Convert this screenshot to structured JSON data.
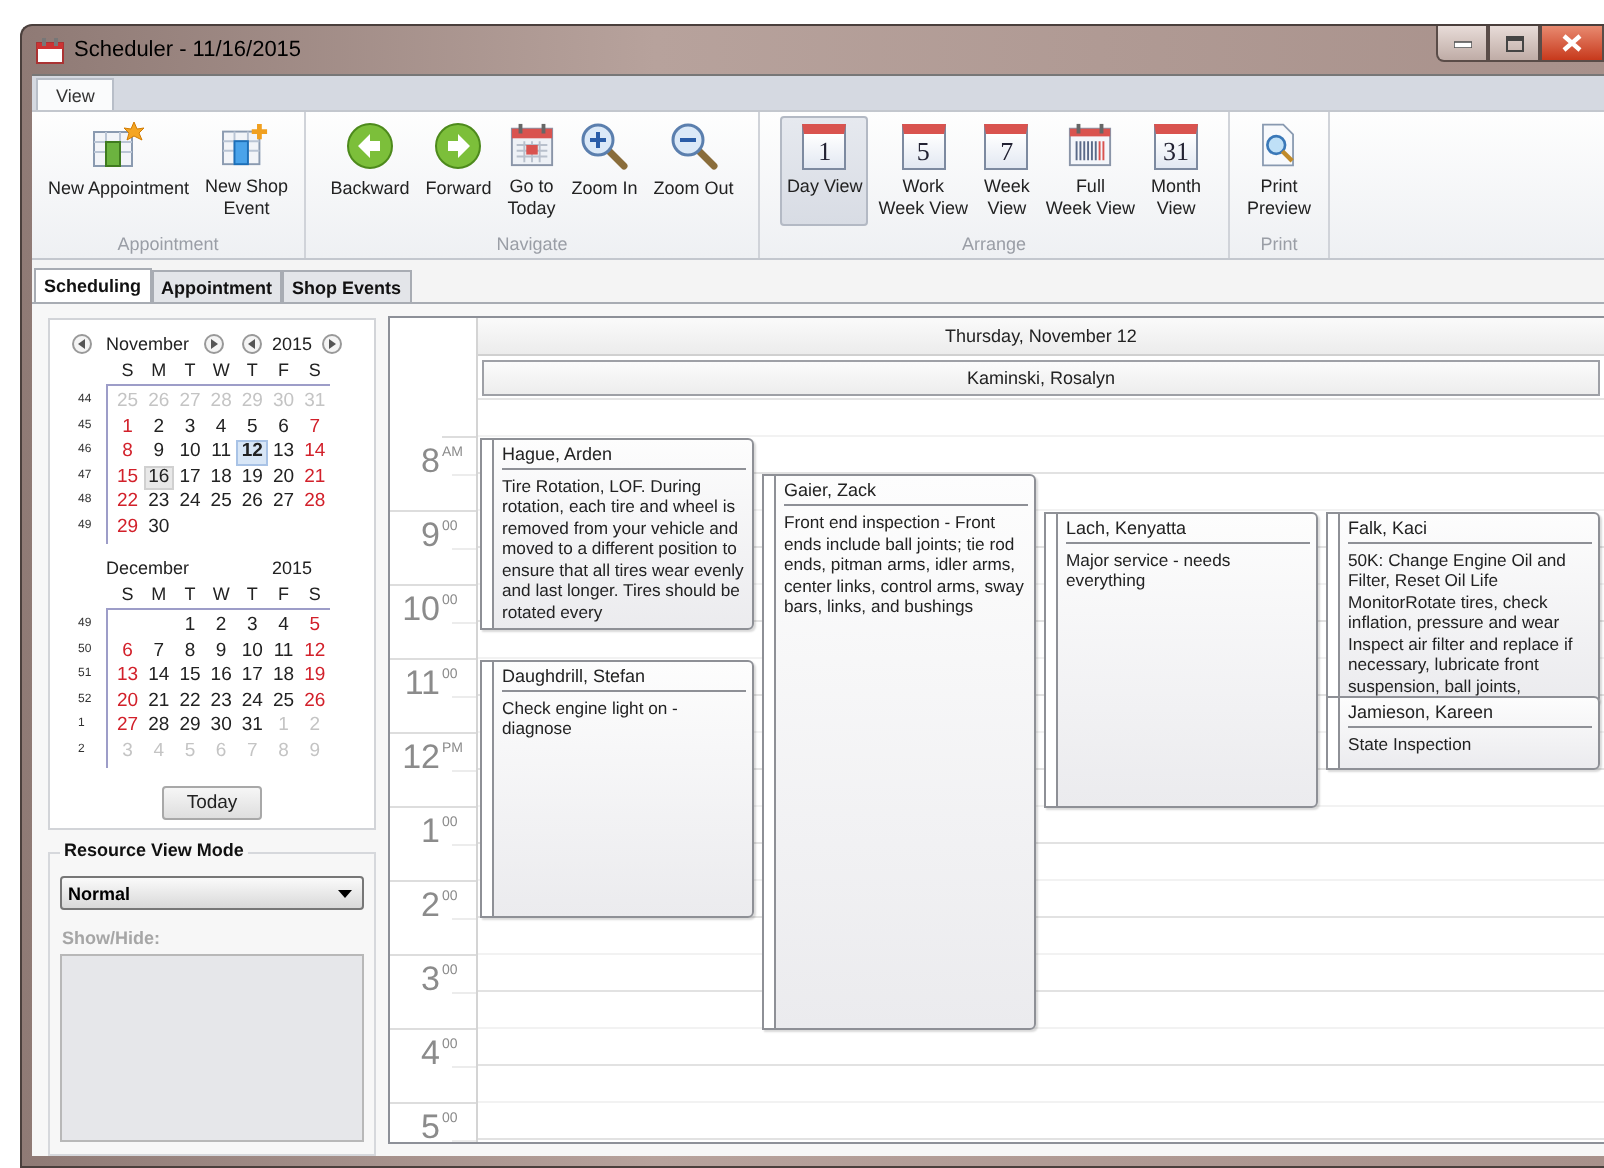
{
  "window": {
    "title": "Scheduler - 11/16/2015"
  },
  "ribbon": {
    "tabs": [
      {
        "label": "View",
        "selected": true
      }
    ],
    "groups": [
      {
        "label": "Appointment",
        "buttons": [
          {
            "lines": [
              "New Appointment"
            ],
            "selected": false
          },
          {
            "lines": [
              "New Shop",
              "Event"
            ],
            "selected": false
          }
        ]
      },
      {
        "label": "Navigate",
        "buttons": [
          {
            "lines": [
              "Backward"
            ],
            "selected": false
          },
          {
            "lines": [
              "Forward"
            ],
            "selected": false
          },
          {
            "lines": [
              "Go to",
              "Today"
            ],
            "selected": false
          },
          {
            "lines": [
              "Zoom In"
            ],
            "selected": false
          },
          {
            "lines": [
              "Zoom Out"
            ],
            "selected": false
          }
        ]
      },
      {
        "label": "Arrange",
        "buttons": [
          {
            "lines": [
              "Day View"
            ],
            "icon_text": "1",
            "selected": true
          },
          {
            "lines": [
              "Work",
              "Week View"
            ],
            "icon_text": "5",
            "selected": false
          },
          {
            "lines": [
              "Week",
              "View"
            ],
            "icon_text": "7",
            "selected": false
          },
          {
            "lines": [
              "Full",
              "Week View"
            ],
            "selected": false
          },
          {
            "lines": [
              "Month",
              "View"
            ],
            "icon_text": "31",
            "selected": false
          }
        ]
      },
      {
        "label": "Print",
        "buttons": [
          {
            "lines": [
              "Print",
              "Preview"
            ],
            "selected": false
          }
        ]
      }
    ]
  },
  "tabs": [
    {
      "label": "Scheduling",
      "selected": true
    },
    {
      "label": "Appointment",
      "selected": false
    },
    {
      "label": "Shop Events",
      "selected": false
    }
  ],
  "date_navigator": {
    "months": [
      {
        "month": "November",
        "year": "2015",
        "day_names": [
          "S",
          "M",
          "T",
          "W",
          "T",
          "F",
          "S"
        ],
        "weeks": [
          {
            "number": "44",
            "days": [
              {
                "d": "25",
                "dim": true,
                "today": false,
                "selected": false
              },
              {
                "d": "26",
                "dim": true,
                "today": false,
                "selected": false
              },
              {
                "d": "27",
                "dim": true,
                "today": false,
                "selected": false
              },
              {
                "d": "28",
                "dim": true,
                "today": false,
                "selected": false
              },
              {
                "d": "29",
                "dim": true,
                "today": false,
                "selected": false
              },
              {
                "d": "30",
                "dim": true,
                "today": false,
                "selected": false
              },
              {
                "d": "31",
                "dim": true,
                "today": false,
                "selected": false
              }
            ]
          },
          {
            "number": "45",
            "days": [
              {
                "d": "1",
                "dim": false,
                "today": false,
                "selected": false
              },
              {
                "d": "2",
                "dim": false,
                "today": false,
                "selected": false
              },
              {
                "d": "3",
                "dim": false,
                "today": false,
                "selected": false
              },
              {
                "d": "4",
                "dim": false,
                "today": false,
                "selected": false
              },
              {
                "d": "5",
                "dim": false,
                "today": false,
                "selected": false
              },
              {
                "d": "6",
                "dim": false,
                "today": false,
                "selected": false
              },
              {
                "d": "7",
                "dim": false,
                "today": false,
                "selected": false
              }
            ]
          },
          {
            "number": "46",
            "days": [
              {
                "d": "8",
                "dim": false,
                "today": false,
                "selected": false
              },
              {
                "d": "9",
                "dim": false,
                "today": false,
                "selected": false
              },
              {
                "d": "10",
                "dim": false,
                "today": false,
                "selected": false
              },
              {
                "d": "11",
                "dim": false,
                "today": false,
                "selected": false
              },
              {
                "d": "12",
                "dim": false,
                "today": false,
                "selected": true
              },
              {
                "d": "13",
                "dim": false,
                "today": false,
                "selected": false
              },
              {
                "d": "14",
                "dim": false,
                "today": false,
                "selected": false
              }
            ]
          },
          {
            "number": "47",
            "days": [
              {
                "d": "15",
                "dim": false,
                "today": false,
                "selected": false
              },
              {
                "d": "16",
                "dim": false,
                "today": true,
                "selected": false
              },
              {
                "d": "17",
                "dim": false,
                "today": false,
                "selected": false
              },
              {
                "d": "18",
                "dim": false,
                "today": false,
                "selected": false
              },
              {
                "d": "19",
                "dim": false,
                "today": false,
                "selected": false
              },
              {
                "d": "20",
                "dim": false,
                "today": false,
                "selected": false
              },
              {
                "d": "21",
                "dim": false,
                "today": false,
                "selected": false
              }
            ]
          },
          {
            "number": "48",
            "days": [
              {
                "d": "22",
                "dim": false,
                "today": false,
                "selected": false
              },
              {
                "d": "23",
                "dim": false,
                "today": false,
                "selected": false
              },
              {
                "d": "24",
                "dim": false,
                "today": false,
                "selected": false
              },
              {
                "d": "25",
                "dim": false,
                "today": false,
                "selected": false
              },
              {
                "d": "26",
                "dim": false,
                "today": false,
                "selected": false
              },
              {
                "d": "27",
                "dim": false,
                "today": false,
                "selected": false
              },
              {
                "d": "28",
                "dim": false,
                "today": false,
                "selected": false
              }
            ]
          },
          {
            "number": "49",
            "days": [
              {
                "d": "29",
                "dim": false,
                "today": false,
                "selected": false
              },
              {
                "d": "30",
                "dim": false,
                "today": false,
                "selected": false
              }
            ]
          }
        ]
      },
      {
        "month": "December",
        "year": "2015",
        "day_names": [
          "S",
          "M",
          "T",
          "W",
          "T",
          "F",
          "S"
        ],
        "weeks": [
          {
            "number": "49",
            "days": [
              {
                "d": "1",
                "dim": false,
                "today": false,
                "selected": false
              },
              {
                "d": "2",
                "dim": false,
                "today": false,
                "selected": false
              },
              {
                "d": "3",
                "dim": false,
                "today": false,
                "selected": false
              },
              {
                "d": "4",
                "dim": false,
                "today": false,
                "selected": false
              },
              {
                "d": "5",
                "dim": false,
                "today": false,
                "selected": false
              }
            ]
          },
          {
            "number": "50",
            "days": [
              {
                "d": "6",
                "dim": false,
                "today": false,
                "selected": false
              },
              {
                "d": "7",
                "dim": false,
                "today": false,
                "selected": false
              },
              {
                "d": "8",
                "dim": false,
                "today": false,
                "selected": false
              },
              {
                "d": "9",
                "dim": false,
                "today": false,
                "selected": false
              },
              {
                "d": "10",
                "dim": false,
                "today": false,
                "selected": false
              },
              {
                "d": "11",
                "dim": false,
                "today": false,
                "selected": false
              },
              {
                "d": "12",
                "dim": false,
                "today": false,
                "selected": false
              }
            ]
          },
          {
            "number": "51",
            "days": [
              {
                "d": "13",
                "dim": false,
                "today": false,
                "selected": false
              },
              {
                "d": "14",
                "dim": false,
                "today": false,
                "selected": false
              },
              {
                "d": "15",
                "dim": false,
                "today": false,
                "selected": false
              },
              {
                "d": "16",
                "dim": false,
                "today": false,
                "selected": false
              },
              {
                "d": "17",
                "dim": false,
                "today": false,
                "selected": false
              },
              {
                "d": "18",
                "dim": false,
                "today": false,
                "selected": false
              },
              {
                "d": "19",
                "dim": false,
                "today": false,
                "selected": false
              }
            ]
          },
          {
            "number": "52",
            "days": [
              {
                "d": "20",
                "dim": false,
                "today": false,
                "selected": false
              },
              {
                "d": "21",
                "dim": false,
                "today": false,
                "selected": false
              },
              {
                "d": "22",
                "dim": false,
                "today": false,
                "selected": false
              },
              {
                "d": "23",
                "dim": false,
                "today": false,
                "selected": false
              },
              {
                "d": "24",
                "dim": false,
                "today": false,
                "selected": false
              },
              {
                "d": "25",
                "dim": false,
                "today": false,
                "selected": false
              },
              {
                "d": "26",
                "dim": false,
                "today": false,
                "selected": false
              }
            ]
          },
          {
            "number": "1",
            "days": [
              {
                "d": "27",
                "dim": false,
                "today": false,
                "selected": false
              },
              {
                "d": "28",
                "dim": false,
                "today": false,
                "selected": false
              },
              {
                "d": "29",
                "dim": false,
                "today": false,
                "selected": false
              },
              {
                "d": "30",
                "dim": false,
                "today": false,
                "selected": false
              },
              {
                "d": "31",
                "dim": false,
                "today": false,
                "selected": false
              },
              {
                "d": "1",
                "dim": true,
                "today": false,
                "selected": false
              },
              {
                "d": "2",
                "dim": true,
                "today": false,
                "selected": false
              }
            ]
          },
          {
            "number": "2",
            "days": [
              {
                "d": "3",
                "dim": true,
                "today": false,
                "selected": false
              },
              {
                "d": "4",
                "dim": true,
                "today": false,
                "selected": false
              },
              {
                "d": "5",
                "dim": true,
                "today": false,
                "selected": false
              },
              {
                "d": "6",
                "dim": true,
                "today": false,
                "selected": false
              },
              {
                "d": "7",
                "dim": true,
                "today": false,
                "selected": false
              },
              {
                "d": "8",
                "dim": true,
                "today": false,
                "selected": false
              },
              {
                "d": "9",
                "dim": true,
                "today": false,
                "selected": false
              }
            ]
          }
        ]
      }
    ],
    "today_button": "Today"
  },
  "resource_view_mode": {
    "title": "Resource View Mode",
    "mode": "Normal",
    "show_hide_label": "Show/Hide:",
    "show_hide_disabled": true
  },
  "scheduler": {
    "day_header": "Thursday, November 12",
    "resource": "Kaminski, Rosalyn",
    "time_labels": [
      {
        "hour": "8",
        "suffix": "AM"
      },
      {
        "hour": "9",
        "suffix": "00"
      },
      {
        "hour": "10",
        "suffix": "00"
      },
      {
        "hour": "11",
        "suffix": "00"
      },
      {
        "hour": "12",
        "suffix": "PM"
      },
      {
        "hour": "1",
        "suffix": "00"
      },
      {
        "hour": "2",
        "suffix": "00"
      },
      {
        "hour": "3",
        "suffix": "00"
      },
      {
        "hour": "4",
        "suffix": "00"
      },
      {
        "hour": "5",
        "suffix": "00"
      }
    ],
    "appointments": [
      {
        "subject": "Hague, Arden",
        "description": "Tire Rotation, LOF.  During rotation, each tire and wheel is removed from your vehicle and moved to a different position to ensure that all tires wear evenly and last longer. Tires should be rotated every"
      },
      {
        "subject": "Daughdrill, Stefan",
        "description": "Check engine light on - diagnose"
      },
      {
        "subject": "Gaier, Zack",
        "description": "Front end inspection - Front ends include ball joints; tie rod ends, pitman arms, idler arms, center links, control arms, sway bars, links, and bushings"
      },
      {
        "subject": "Lach, Kenyatta",
        "description": "Major service - needs everything"
      },
      {
        "subject": "Falk, Kaci",
        "description": "50K: Change Engine Oil and Filter, Reset Oil Life MonitorRotate tires, check inflation, pressure and wear Inspect air filter and replace if necessary, lubricate front suspension, ball joints,"
      },
      {
        "subject": "Jamieson, Kareen",
        "description": "State Inspection"
      }
    ]
  }
}
